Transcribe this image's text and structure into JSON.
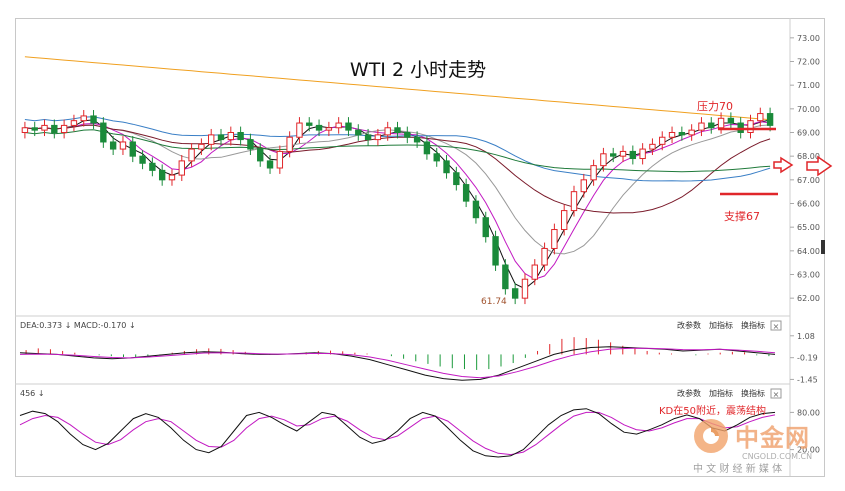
{
  "chart_data": [
    {
      "type": "candlestick",
      "title": "WTI 2 小时走势",
      "y_ticks": [
        "73.00",
        "72.00",
        "71.00",
        "70.00",
        "69.00",
        "68.00",
        "67.00",
        "66.00",
        "65.00",
        "64.00",
        "63.00",
        "62.00"
      ],
      "ylim": [
        61.5,
        73.5
      ],
      "annotations": {
        "resistance": {
          "label": "压力70",
          "value": 70.0
        },
        "support": {
          "label": "支撑67",
          "value": 67.0
        },
        "low": {
          "label": "61.74",
          "value": 61.74
        }
      },
      "close_series": [
        69.2,
        69.1,
        69.3,
        69.0,
        69.3,
        69.5,
        69.7,
        69.4,
        68.6,
        68.3,
        68.6,
        68.0,
        67.7,
        67.4,
        67.0,
        67.2,
        67.8,
        68.3,
        68.5,
        68.9,
        68.7,
        69.0,
        68.7,
        68.3,
        67.8,
        67.5,
        68.2,
        68.8,
        69.4,
        69.3,
        69.1,
        69.2,
        69.4,
        69.1,
        68.9,
        68.7,
        68.9,
        69.2,
        69.0,
        68.8,
        68.6,
        68.1,
        67.8,
        67.3,
        66.8,
        66.1,
        65.4,
        64.6,
        63.4,
        62.4,
        62.0,
        62.8,
        63.4,
        64.1,
        64.9,
        65.7,
        66.5,
        67.0,
        67.6,
        68.1,
        68.0,
        68.2,
        67.9,
        68.3,
        68.5,
        68.8,
        69.0,
        68.9,
        69.1,
        69.4,
        69.2,
        69.6,
        69.4,
        69.0,
        69.5,
        69.8,
        69.3
      ]
    },
    {
      "type": "macd",
      "header": "DEA:0.373 ↓  MACD:-0.170 ↓",
      "buttons": [
        "改参数",
        "加指标",
        "换指标"
      ],
      "close_label": "×",
      "y_ticks": [
        "1.08",
        "-0.19",
        "-1.45"
      ],
      "ylim": [
        -1.6,
        1.3
      ],
      "hist": [
        0.25,
        0.35,
        0.3,
        0.2,
        0.1,
        0.0,
        -0.05,
        -0.1,
        -0.15,
        -0.2,
        -0.12,
        -0.05,
        0.1,
        0.2,
        0.3,
        0.35,
        0.32,
        0.25,
        0.15,
        0.05,
        -0.02,
        0.0,
        0.05,
        0.12,
        0.2,
        0.22,
        0.18,
        0.1,
        0.05,
        0.0,
        -0.1,
        -0.25,
        -0.4,
        -0.55,
        -0.7,
        -0.8,
        -0.85,
        -0.9,
        -0.85,
        -0.7,
        -0.5,
        -0.2,
        0.2,
        0.6,
        0.9,
        1.0,
        0.95,
        0.85,
        0.7,
        0.5,
        0.35,
        0.2,
        0.1,
        0.05,
        0.0,
        -0.05,
        0.05,
        0.1,
        0.15,
        0.12,
        -0.05,
        -0.1
      ],
      "dif": [
        0.1,
        0.05,
        0.0,
        -0.1,
        -0.2,
        -0.25,
        -0.2,
        -0.1,
        0.0,
        0.1,
        0.15,
        0.12,
        0.05,
        0.0,
        0.0,
        0.05,
        0.1,
        0.05,
        -0.1,
        -0.3,
        -0.6,
        -0.9,
        -1.2,
        -1.4,
        -1.5,
        -1.45,
        -1.2,
        -0.8,
        -0.4,
        0.0,
        0.25,
        0.4,
        0.45,
        0.4,
        0.35,
        0.3,
        0.2,
        0.25,
        0.3,
        0.2,
        0.1,
        0.0
      ],
      "dea": [
        0.0,
        0.02,
        0.0,
        -0.05,
        -0.12,
        -0.18,
        -0.2,
        -0.15,
        -0.08,
        0.0,
        0.08,
        0.1,
        0.08,
        0.04,
        0.02,
        0.03,
        0.06,
        0.05,
        -0.02,
        -0.15,
        -0.35,
        -0.6,
        -0.85,
        -1.1,
        -1.28,
        -1.35,
        -1.25,
        -1.0,
        -0.7,
        -0.35,
        -0.05,
        0.15,
        0.3,
        0.35,
        0.36,
        0.33,
        0.28,
        0.27,
        0.3,
        0.25,
        0.18,
        0.1
      ]
    },
    {
      "type": "kd",
      "header": "456 ↓",
      "buttons": [
        "改参数",
        "加指标",
        "换指标"
      ],
      "close_label": "×",
      "y_ticks": [
        "80.00",
        "20.00"
      ],
      "ylim": [
        0,
        100
      ],
      "annotation": "KD在50附近，震荡结构",
      "k": [
        75,
        82,
        78,
        65,
        45,
        28,
        20,
        30,
        50,
        70,
        78,
        72,
        55,
        35,
        20,
        15,
        25,
        50,
        75,
        80,
        72,
        60,
        50,
        65,
        80,
        76,
        58,
        40,
        30,
        35,
        50,
        70,
        80,
        74,
        55,
        35,
        18,
        10,
        8,
        10,
        20,
        40,
        60,
        75,
        84,
        86,
        78,
        62,
        48,
        45,
        52,
        60,
        70,
        76,
        70,
        55,
        50,
        60,
        72,
        78,
        80
      ],
      "d": [
        60,
        70,
        75,
        72,
        60,
        45,
        32,
        28,
        36,
        52,
        65,
        70,
        65,
        50,
        35,
        25,
        24,
        35,
        55,
        70,
        74,
        68,
        58,
        60,
        70,
        74,
        66,
        52,
        40,
        36,
        42,
        56,
        70,
        74,
        66,
        50,
        34,
        22,
        14,
        12,
        16,
        28,
        44,
        60,
        74,
        80,
        80,
        72,
        60,
        52,
        50,
        55,
        63,
        70,
        70,
        62,
        55,
        57,
        65,
        72,
        76
      ]
    }
  ],
  "watermark": {
    "name": "中金网",
    "url": "CNGOLD.COM.CN",
    "slogan": "中 文 财 经 新 媒 体"
  }
}
